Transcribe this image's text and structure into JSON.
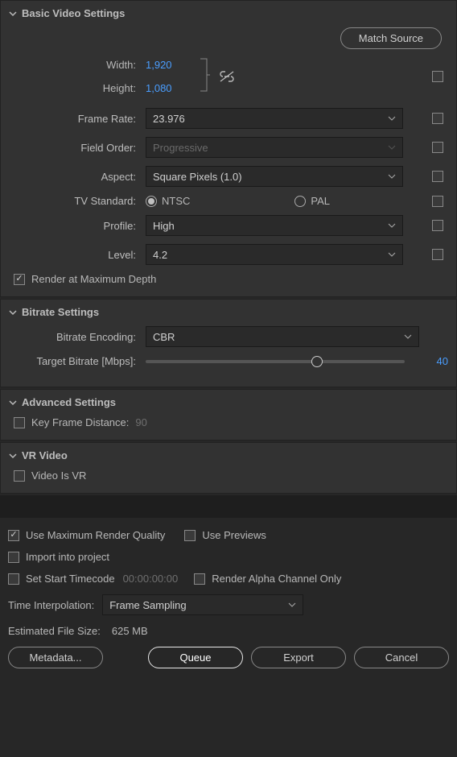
{
  "basicVideo": {
    "title": "Basic Video Settings",
    "matchSource": "Match Source",
    "widthLabel": "Width:",
    "widthValue": "1,920",
    "heightLabel": "Height:",
    "heightValue": "1,080",
    "frameRateLabel": "Frame Rate:",
    "frameRateValue": "23.976",
    "fieldOrderLabel": "Field Order:",
    "fieldOrderValue": "Progressive",
    "aspectLabel": "Aspect:",
    "aspectValue": "Square Pixels (1.0)",
    "tvStandardLabel": "TV Standard:",
    "tvOptionNTSC": "NTSC",
    "tvOptionPAL": "PAL",
    "profileLabel": "Profile:",
    "profileValue": "High",
    "levelLabel": "Level:",
    "levelValue": "4.2",
    "renderMaxDepth": "Render at Maximum Depth"
  },
  "bitrate": {
    "title": "Bitrate Settings",
    "encodingLabel": "Bitrate Encoding:",
    "encodingValue": "CBR",
    "targetLabel": "Target Bitrate [Mbps]:",
    "targetValue": "40"
  },
  "advanced": {
    "title": "Advanced Settings",
    "keyFrameLabel": "Key Frame Distance:",
    "keyFrameValue": "90"
  },
  "vr": {
    "title": "VR Video",
    "videoIsVR": "Video Is VR"
  },
  "footer": {
    "useMaxRender": "Use Maximum Render Quality",
    "usePreviews": "Use Previews",
    "importProject": "Import into project",
    "setStartTimecode": "Set Start Timecode",
    "timecodeValue": "00:00:00:00",
    "renderAlpha": "Render Alpha Channel Only",
    "timeInterpLabel": "Time Interpolation:",
    "timeInterpValue": "Frame Sampling",
    "estFileSizeLabel": "Estimated File Size:",
    "estFileSizeValue": "625 MB",
    "metadata": "Metadata...",
    "queue": "Queue",
    "export": "Export",
    "cancel": "Cancel"
  }
}
